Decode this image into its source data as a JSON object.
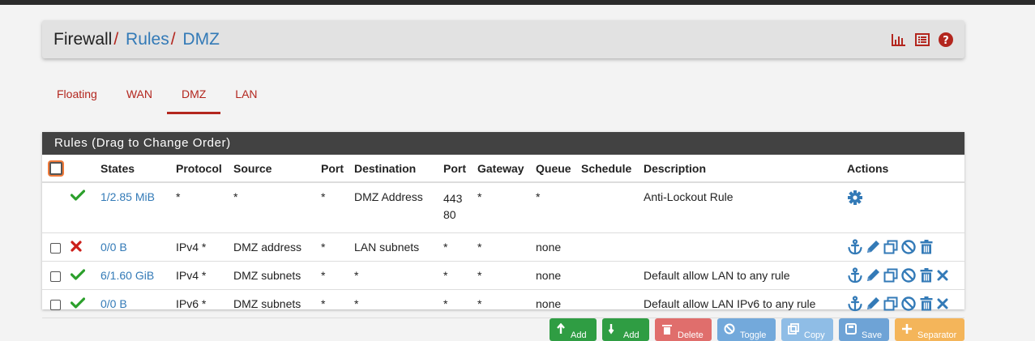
{
  "breadcrumb": {
    "root": "Firewall",
    "sep": "/",
    "section": "Rules",
    "current": "DMZ"
  },
  "header_icons": [
    "chart-icon",
    "list-icon",
    "help-icon"
  ],
  "tabs": [
    {
      "label": "Floating",
      "active": false
    },
    {
      "label": "WAN",
      "active": false
    },
    {
      "label": "DMZ",
      "active": true
    },
    {
      "label": "LAN",
      "active": false
    }
  ],
  "panel": {
    "title": "Rules (Drag to Change Order)"
  },
  "columns": [
    "States",
    "Protocol",
    "Source",
    "Port",
    "Destination",
    "Port",
    "Gateway",
    "Queue",
    "Schedule",
    "Description",
    "Actions"
  ],
  "rows": [
    {
      "status": "check",
      "states": "1/2.85 MiB",
      "protocol": "*",
      "source": "*",
      "sport": "*",
      "destination": "DMZ Address",
      "dport_1": "443",
      "dport_2": "80",
      "gateway": "*",
      "queue": "*",
      "schedule": "",
      "description": "Anti-Lockout Rule"
    },
    {
      "status": "cross",
      "states": "0/0 B",
      "protocol": "IPv4 *",
      "source": "DMZ address",
      "sport": "*",
      "destination": "LAN subnets",
      "dport": "*",
      "gateway": "*",
      "queue": "none",
      "schedule": "",
      "description": ""
    },
    {
      "status": "check",
      "states": "6/1.60 GiB",
      "protocol": "IPv4 *",
      "source": "DMZ subnets",
      "sport": "*",
      "destination": "*",
      "dport": "*",
      "gateway": "*",
      "queue": "none",
      "schedule": "",
      "description": "Default allow LAN to any rule"
    },
    {
      "status": "check",
      "states": "0/0 B",
      "protocol": "IPv6 *",
      "source": "DMZ subnets",
      "sport": "*",
      "destination": "*",
      "dport": "*",
      "gateway": "*",
      "queue": "none",
      "schedule": "",
      "description": "Default allow LAN IPv6 to any rule"
    }
  ],
  "buttons": {
    "add_top": "Add",
    "add_bottom": "Add",
    "delete": "Delete",
    "toggle": "Toggle",
    "copy": "Copy",
    "save": "Save",
    "separator": "Separator"
  },
  "colors": {
    "accent_red": "#b3261e",
    "link_blue": "#337ab7",
    "pass_green": "#2ca02c",
    "block_red": "#cc1f1a",
    "header_dark": "#424242"
  }
}
